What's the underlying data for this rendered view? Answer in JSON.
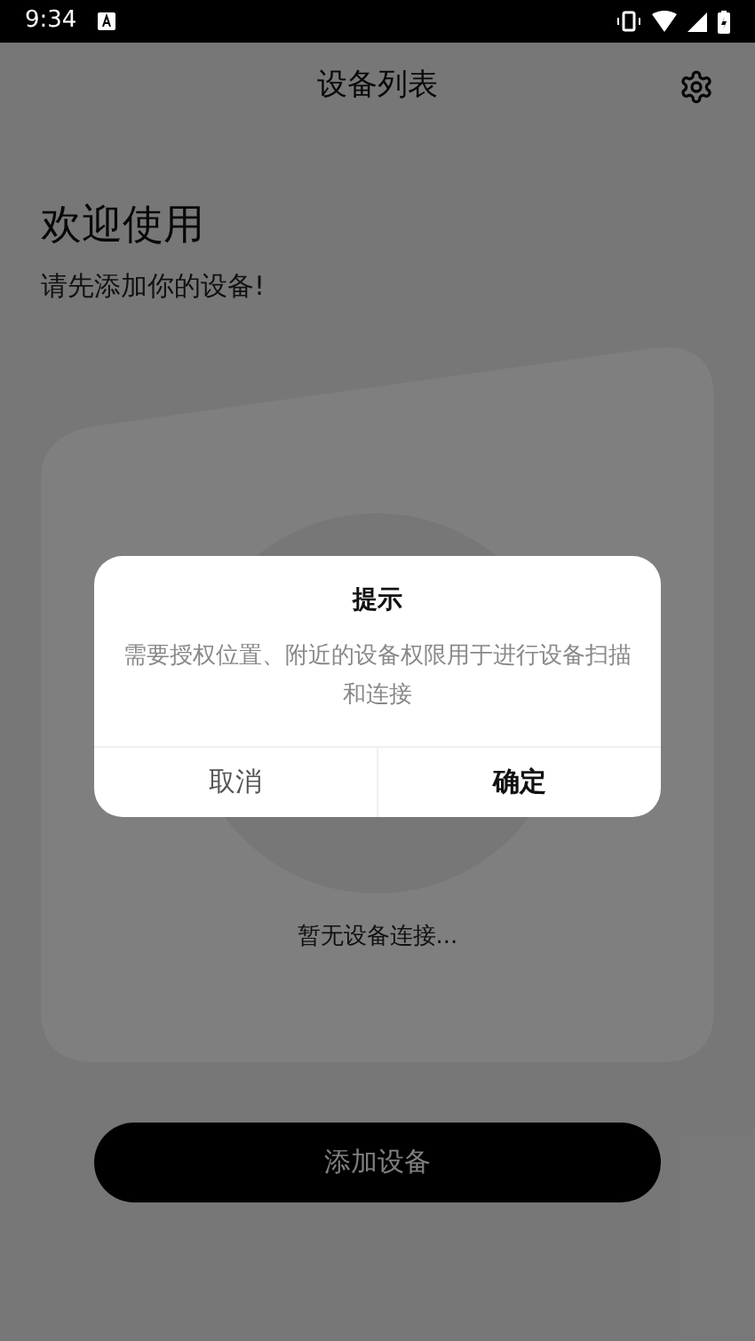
{
  "status_bar": {
    "time": "9:34"
  },
  "header": {
    "title": "设备列表"
  },
  "welcome": {
    "title": "欢迎使用",
    "subtitle": "请先添加你的设备!"
  },
  "empty_text": "暂无设备连接...",
  "add_button": "添加设备",
  "dialog": {
    "title": "提示",
    "message": "需要授权位置、附近的设备权限用于进行设备扫描和连接",
    "buttons": [
      {
        "label": "取消",
        "emphasized": false
      },
      {
        "label": "确定",
        "emphasized": true
      }
    ]
  }
}
